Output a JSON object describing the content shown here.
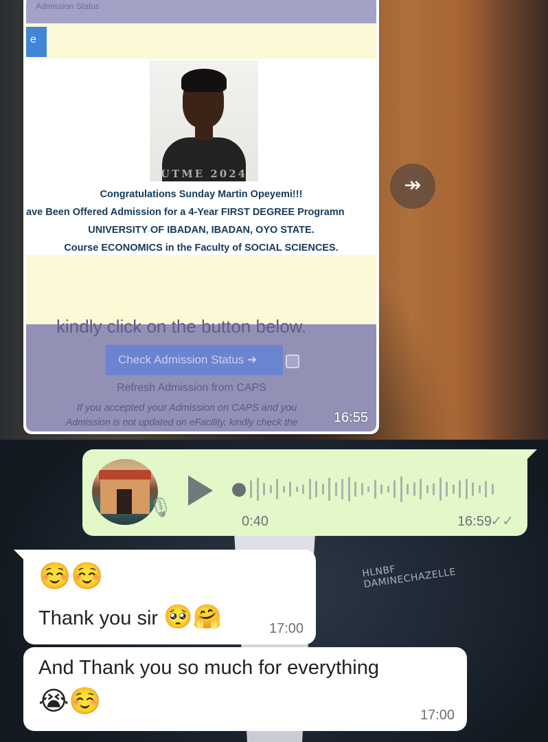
{
  "screenshot": {
    "top_text": "Admission Status",
    "blue_btn_char": "e",
    "photo_stamp": "UTME 2024",
    "admission": {
      "line1": "Congratulations Sunday Martin Opeyemi!!!",
      "line2": "ave Been Offered Admission for a 4-Year FIRST DEGREE Programn",
      "line3": "UNIVERSITY OF IBADAN, IBADAN, OYO STATE.",
      "line4": "Course ECONOMICS in the Faculty of SOCIAL SCIENCES."
    },
    "kindly_text": "kindly click on the button below.",
    "check_button": "Check Admission Status ➜",
    "refresh_text": "Refresh Admission from CAPS",
    "accepted_text": "If you accepted your Admission on CAPS and you",
    "accepted_text2": "Admission is not updated on eFacility, kindly check the"
  },
  "image_message": {
    "time": "16:55"
  },
  "forward_icon": "↠",
  "voice_note": {
    "duration": "0:40",
    "time": "16:59",
    "ticks": "✓✓",
    "mic_icon": "🎙"
  },
  "messages": [
    {
      "emoji_line": "☺️☺️",
      "text": "Thank you sir",
      "text_emojis": "🥺🤗",
      "time": "17:00"
    },
    {
      "text": "And Thank you so much for everything",
      "emoji_line": "😭☺️",
      "time": "17:00"
    }
  ],
  "background_tag": "HLNBF\nDAMINECHAZELLE"
}
